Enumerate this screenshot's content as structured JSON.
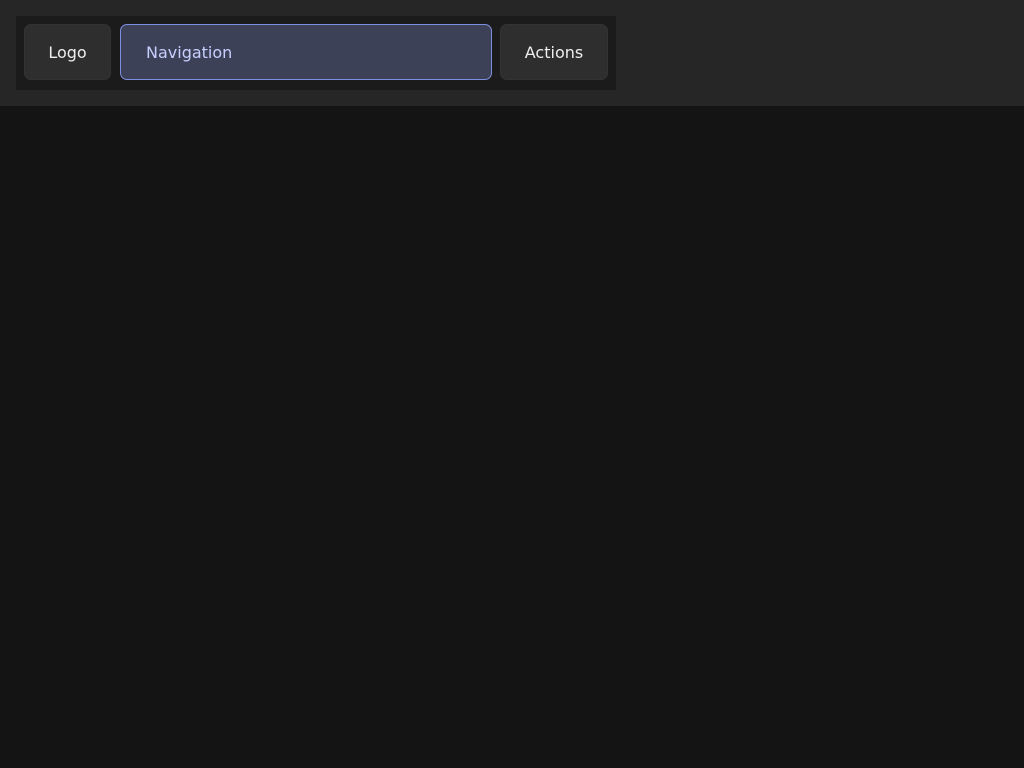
{
  "header": {
    "items": [
      {
        "id": "logo",
        "label": "Logo",
        "state": "default"
      },
      {
        "id": "navigation",
        "label": "Navigation",
        "state": "selected"
      },
      {
        "id": "actions",
        "label": "Actions",
        "state": "default"
      }
    ]
  },
  "colors": {
    "page_background": "#141414",
    "topbar_background": "#262626",
    "toolbar_background": "#1b1b1b",
    "button_background": "#2e2e2e",
    "selected_background": "#3d4157",
    "selected_border": "#7c8fe0",
    "selected_text": "#c7cfff",
    "text": "#eeeeee"
  }
}
